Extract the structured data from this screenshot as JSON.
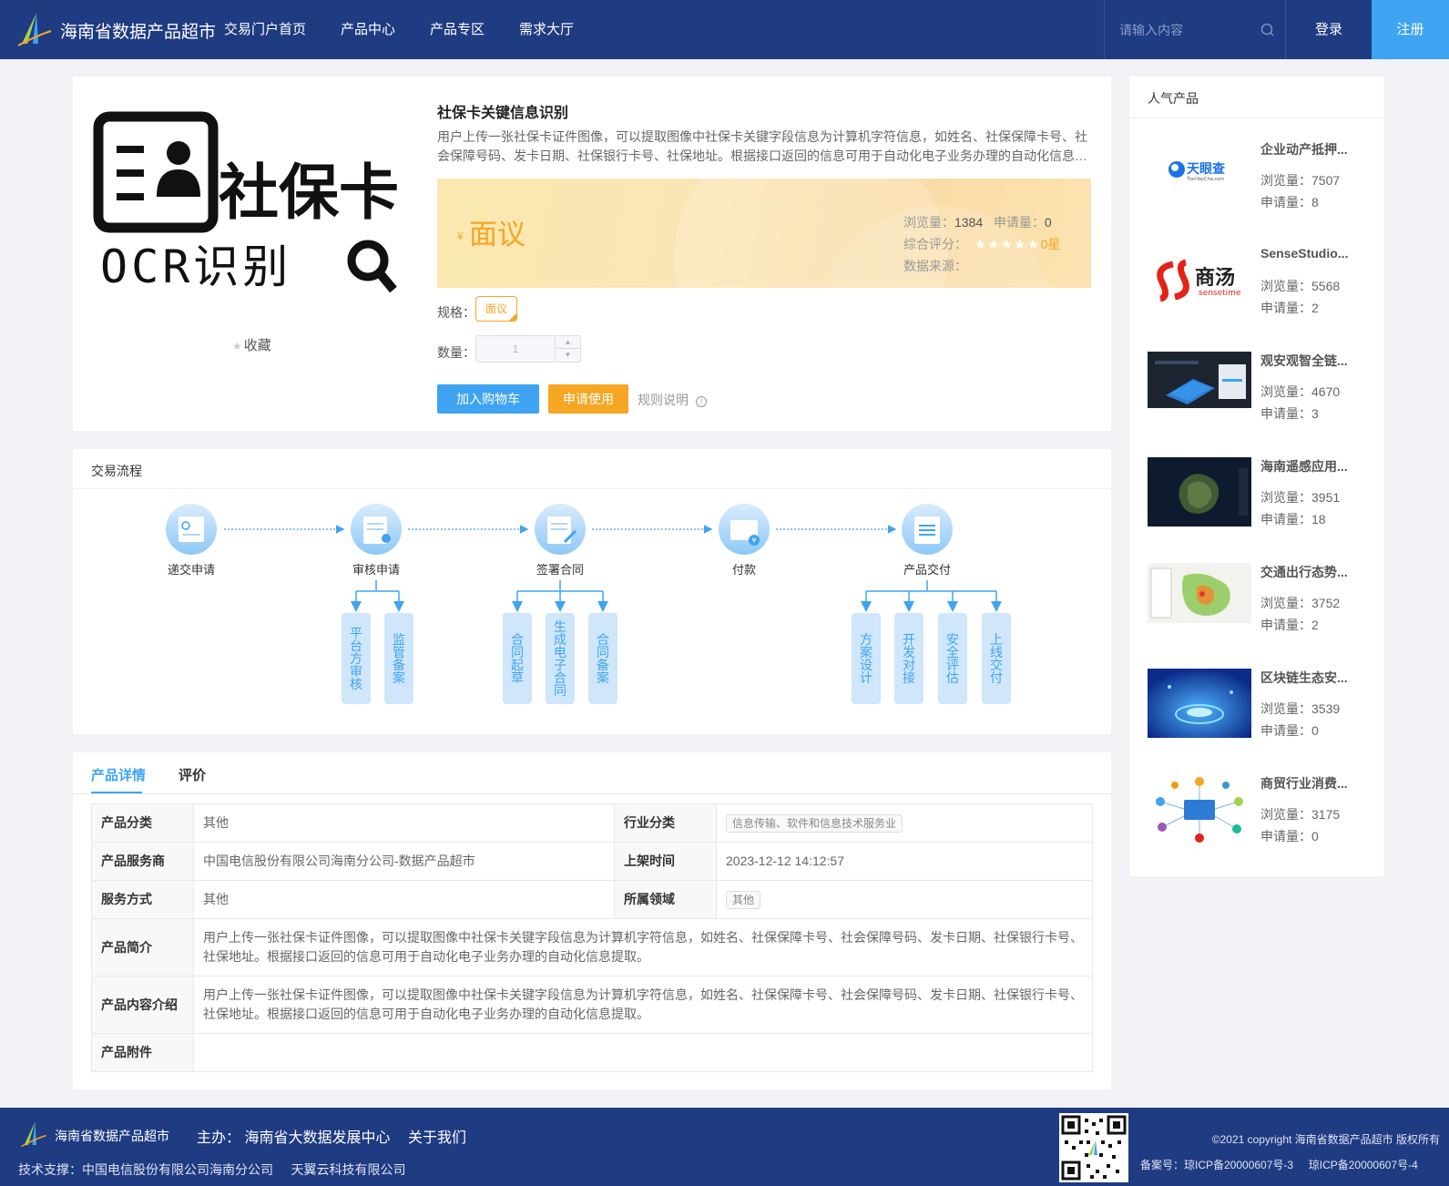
{
  "header": {
    "site_name": "海南省数据产品超市",
    "nav": [
      "交易门户首页",
      "产品中心",
      "产品专区",
      "需求大厅"
    ],
    "search_placeholder": "请输入内容",
    "login": "登录",
    "register": "注册"
  },
  "product": {
    "image_text_line1": "社保卡",
    "image_text_line2": "OCR识别",
    "favorite": "收藏",
    "title": "社保卡关键信息识别",
    "description": "用户上传一张社保卡证件图像，可以提取图像中社保卡关键字段信息为计算机字符信息，如姓名、社保保障卡号、社会保障号码、发卡日期、社保银行卡号、社保地址。根据接口返回的信息可用于自动化电子业务办理的自动化信息提取。",
    "currency": "¥",
    "price": "面议",
    "views_label": "浏览量：",
    "views": "1384",
    "applications_label": "申请量：",
    "applications": "0",
    "rating_label": "综合评分：",
    "rating_stars": "★★★★★",
    "rating": "0星",
    "source_label": "数据来源：",
    "spec_label": "规格：",
    "spec_value": "面议",
    "qty_label": "数量：",
    "qty_value": "1",
    "add_to_cart": "加入购物车",
    "apply": "申请使用",
    "rules": "规则说明",
    "accent_color": "#3ea4f2",
    "price_color": "#f5a623"
  },
  "flow": {
    "title": "交易流程",
    "steps": [
      "递交申请",
      "审核申请",
      "签署合同",
      "付款",
      "产品交付"
    ],
    "sub_review": [
      "平台方审核",
      "监管备案"
    ],
    "sub_contract": [
      "合同起草",
      "生成电子合同",
      "合同备案"
    ],
    "sub_delivery": [
      "方案设计",
      "开发对接",
      "安全评估",
      "上线交付"
    ]
  },
  "details": {
    "tabs": [
      "产品详情",
      "评价"
    ],
    "rows": {
      "category_k": "产品分类",
      "category_v": "其他",
      "industry_k": "行业分类",
      "industry_v": "信息传输、软件和信息技术服务业",
      "provider_k": "产品服务商",
      "provider_v": "中国电信股份有限公司海南分公司-数据产品超市",
      "listed_k": "上架时间",
      "listed_v": "2023-12-12 14:12:57",
      "service_k": "服务方式",
      "service_v": "其他",
      "domain_k": "所属领域",
      "domain_v": "其他",
      "intro_k": "产品简介",
      "intro_v": "用户上传一张社保卡证件图像，可以提取图像中社保卡关键字段信息为计算机字符信息，如姓名、社保保障卡号、社会保障号码、发卡日期、社保银行卡号、社保地址。根据接口返回的信息可用于自动化电子业务办理的自动化信息提取。",
      "content_k": "产品内容介绍",
      "content_v": "用户上传一张社保卡证件图像，可以提取图像中社保卡关键字段信息为计算机字符信息，如姓名、社保保障卡号、社会保障号码、发卡日期、社保银行卡号、社保地址。根据接口返回的信息可用于自动化电子业务办理的自动化信息提取。",
      "attach_k": "产品附件",
      "attach_v": ""
    }
  },
  "sidebar": {
    "title": "人气产品",
    "views_label": "浏览量：",
    "applications_label": "申请量：",
    "items": [
      {
        "name": "企业动产抵押...",
        "views": "7507",
        "applications": "8",
        "logo_text": "天眼查",
        "logo_sub": "TianYanCha.com"
      },
      {
        "name": "SenseStudio...",
        "views": "5568",
        "applications": "2",
        "logo_text": "商汤",
        "logo_sub": "sensetime"
      },
      {
        "name": "观安观智全链...",
        "views": "4670",
        "applications": "3"
      },
      {
        "name": "海南遥感应用...",
        "views": "3951",
        "applications": "18"
      },
      {
        "name": "交通出行态势...",
        "views": "3752",
        "applications": "2"
      },
      {
        "name": "区块链生态安...",
        "views": "3539",
        "applications": "0"
      },
      {
        "name": "商贸行业消费...",
        "views": "3175",
        "applications": "0"
      }
    ]
  },
  "footer": {
    "site_name": "海南省数据产品超市",
    "host": "主办： 海南省大数据发展中心",
    "about": "关于我们",
    "tech_support": "技术支撑：中国电信股份有限公司海南分公司     天翼云科技有限公司",
    "copyright": "©2021 copyright 海南省数据产品超市 版权所有",
    "icp": "备案号：琼ICP备20000607号-3     琼ICP备20000607号-4"
  }
}
